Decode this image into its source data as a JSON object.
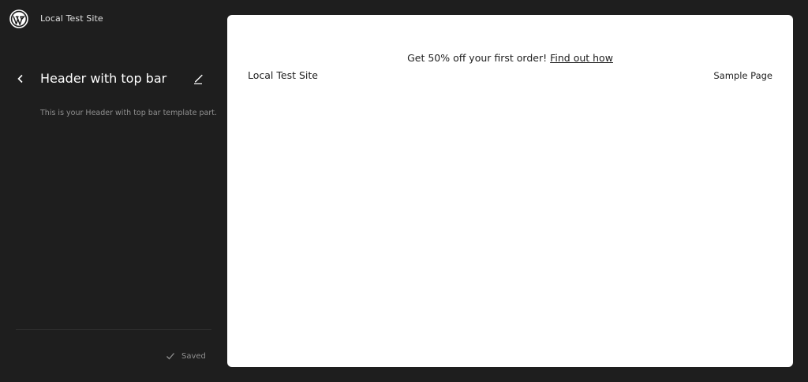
{
  "site_hub": {
    "logo_icon": "wordpress-logo-icon",
    "site_title": "Local Test Site"
  },
  "panel": {
    "back_icon": "chevron-left-icon",
    "title": "Header with top bar",
    "edit_icon": "pencil-icon",
    "description": "This is your Header with top bar template part."
  },
  "footer": {
    "status_icon": "check-icon",
    "status_text": "Saved"
  },
  "preview": {
    "banner_text": "Get 50% off your first order!",
    "banner_link": "Find out how",
    "site_name": "Local Test Site",
    "nav_items": [
      "Sample Page"
    ]
  },
  "colors": {
    "sidebar_bg": "#1e1e1e",
    "canvas_bg": "#ffffff",
    "muted_text": "#8f8f8f"
  }
}
